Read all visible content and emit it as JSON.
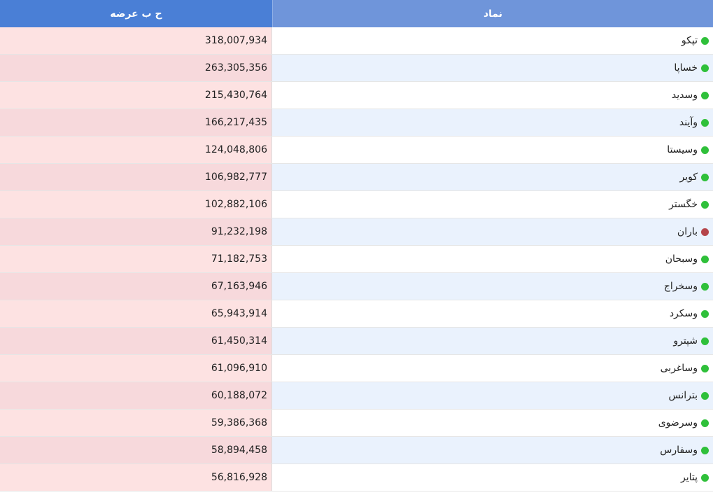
{
  "header": {
    "offer_label": "ح ب عرضه",
    "symbol_label": "نماد"
  },
  "colors": {
    "up": "#2fc03a",
    "down": "#b5444a"
  },
  "rows": [
    {
      "symbol": "تپکو",
      "offer": "318,007,934",
      "status": "up"
    },
    {
      "symbol": "خساپا",
      "offer": "263,305,356",
      "status": "up"
    },
    {
      "symbol": "وسدید",
      "offer": "215,430,764",
      "status": "up"
    },
    {
      "symbol": "وآیند",
      "offer": "166,217,435",
      "status": "up"
    },
    {
      "symbol": "وسیستا",
      "offer": "124,048,806",
      "status": "up"
    },
    {
      "symbol": "کویر",
      "offer": "106,982,777",
      "status": "up"
    },
    {
      "symbol": "خگستر",
      "offer": "102,882,106",
      "status": "up"
    },
    {
      "symbol": "باران",
      "offer": "91,232,198",
      "status": "down"
    },
    {
      "symbol": "وسبحان",
      "offer": "71,182,753",
      "status": "up"
    },
    {
      "symbol": "وسخراج",
      "offer": "67,163,946",
      "status": "up"
    },
    {
      "symbol": "وسکرد",
      "offer": "65,943,914",
      "status": "up"
    },
    {
      "symbol": "شپترو",
      "offer": "61,450,314",
      "status": "up"
    },
    {
      "symbol": "وساغربی",
      "offer": "61,096,910",
      "status": "up"
    },
    {
      "symbol": "بترانس",
      "offer": "60,188,072",
      "status": "up"
    },
    {
      "symbol": "وسرضوی",
      "offer": "59,386,368",
      "status": "up"
    },
    {
      "symbol": "وسفارس",
      "offer": "58,894,458",
      "status": "up"
    },
    {
      "symbol": "پتایر",
      "offer": "56,816,928",
      "status": "up"
    }
  ]
}
